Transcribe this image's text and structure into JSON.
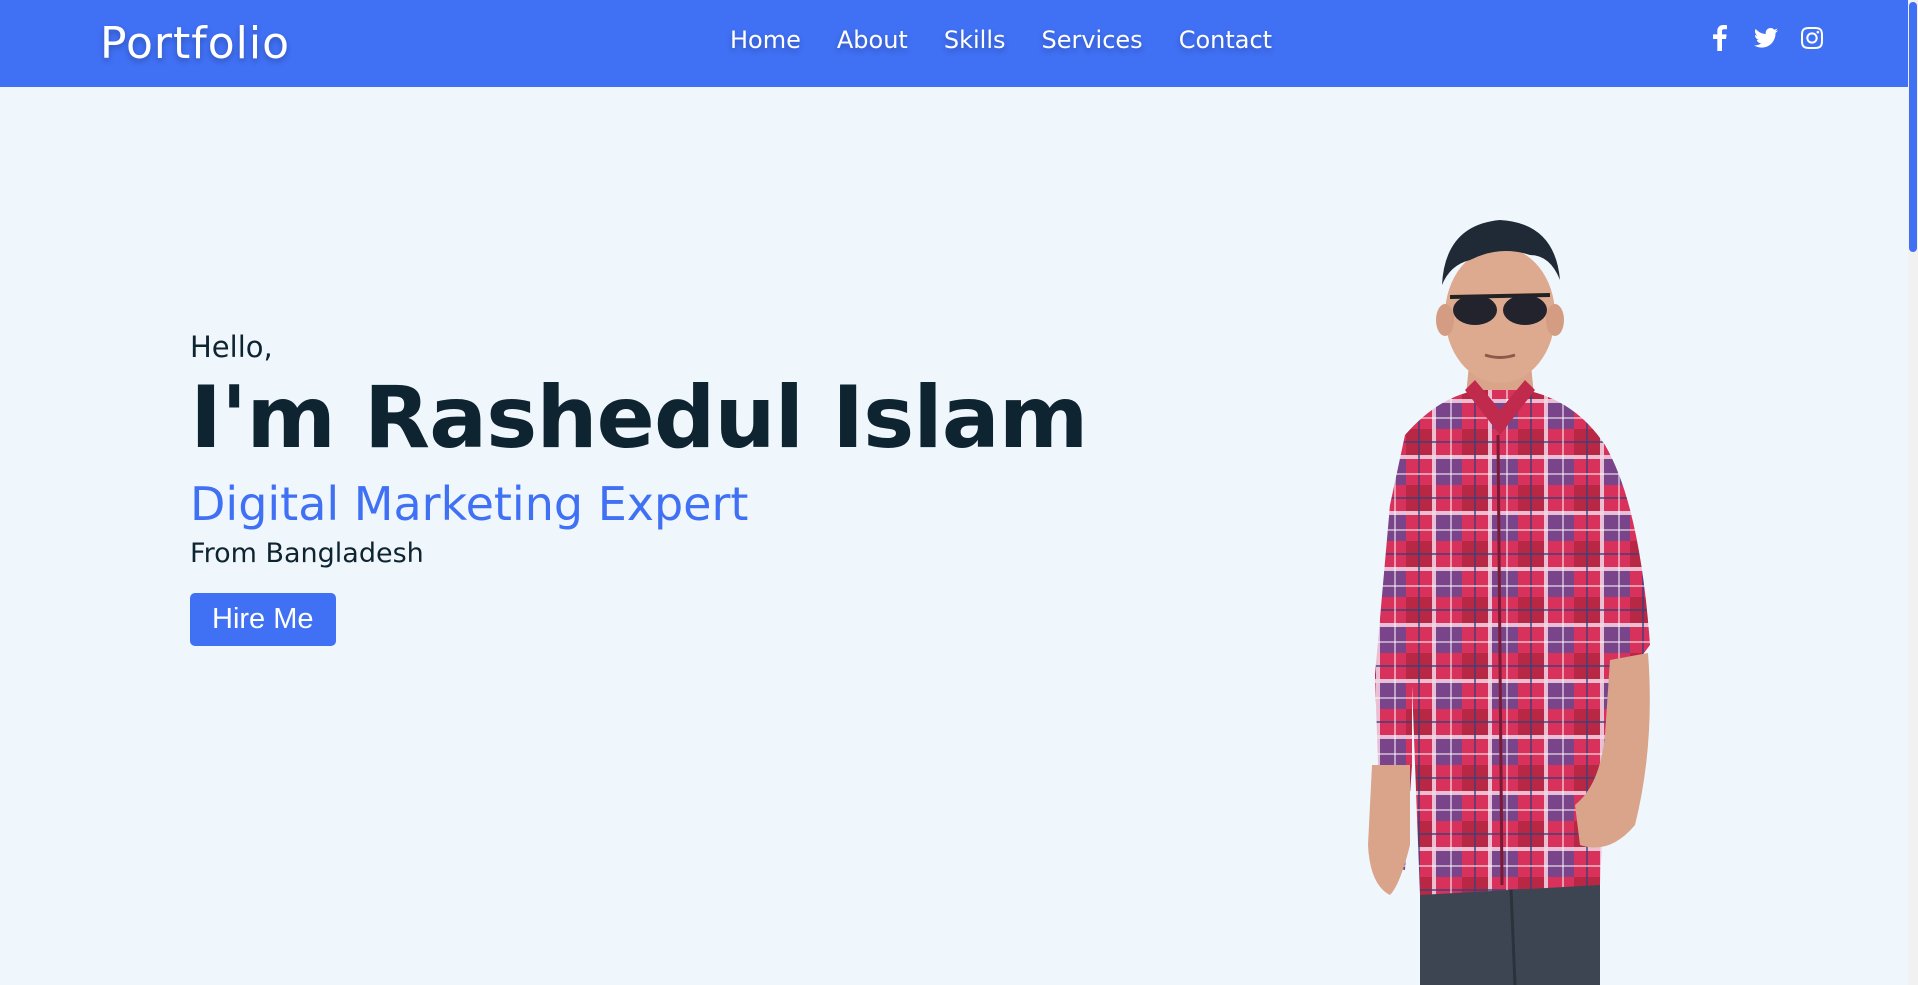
{
  "navbar": {
    "brand": "Portfolio",
    "links": [
      "Home",
      "About",
      "Skills",
      "Services",
      "Contact"
    ],
    "social_icons": [
      "facebook-icon",
      "twitter-icon",
      "instagram-icon"
    ]
  },
  "hero": {
    "greeting": "Hello,",
    "name": "I'm Rashedul Islam",
    "role": "Digital Marketing Expert",
    "origin": "From Bangladesh",
    "cta_label": "Hire Me"
  },
  "colors": {
    "accent": "#4070f4",
    "background": "#eff7fd",
    "text_dark": "#0e2431"
  }
}
